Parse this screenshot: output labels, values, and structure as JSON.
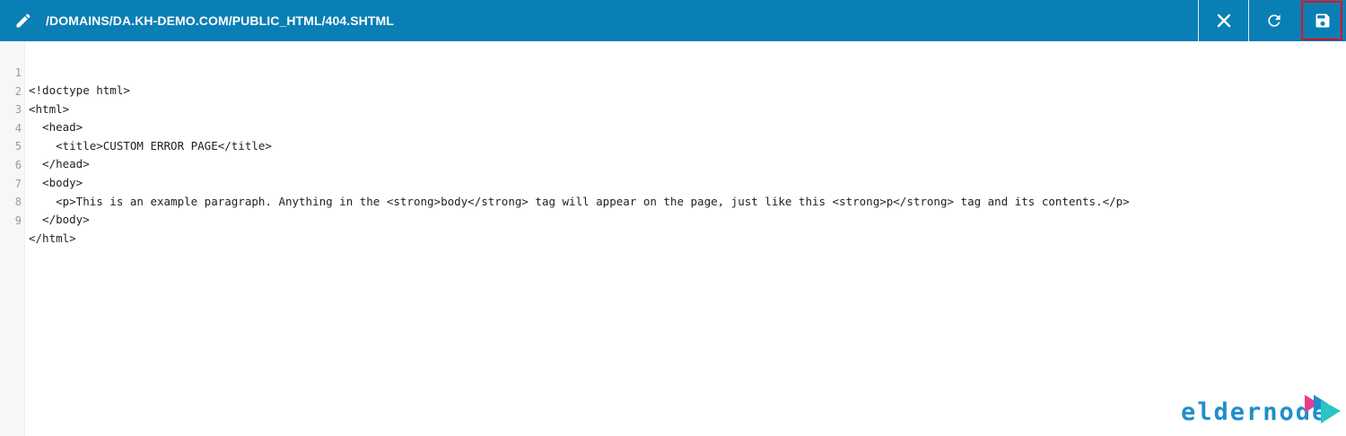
{
  "toolbar": {
    "file_path": "/DOMAINS/DA.KH-DEMO.COM/PUBLIC_HTML/404.SHTML",
    "icons": {
      "edit": "pencil-icon",
      "close": "close-icon",
      "reload": "reload-icon",
      "save": "save-icon"
    },
    "colors": {
      "background": "#0a7fb5",
      "highlight": "#e0121f"
    }
  },
  "editor": {
    "lines": [
      {
        "number": "1",
        "code": "<!doctype html>"
      },
      {
        "number": "2",
        "code": "<html>"
      },
      {
        "number": "3",
        "code": "  <head>"
      },
      {
        "number": "4",
        "code": "    <title>CUSTOM ERROR PAGE</title>"
      },
      {
        "number": "5",
        "code": "  </head>"
      },
      {
        "number": "6",
        "code": "  <body>"
      },
      {
        "number": "7",
        "code": "    <p>This is an example paragraph. Anything in the <strong>body</strong> tag will appear on the page, just like this <strong>p</strong> tag and its contents.</p>"
      },
      {
        "number": "8",
        "code": "  </body>"
      },
      {
        "number": "9",
        "code": "</html>"
      }
    ]
  },
  "watermark": {
    "text": "eldernode",
    "color": "#1f8fca"
  }
}
